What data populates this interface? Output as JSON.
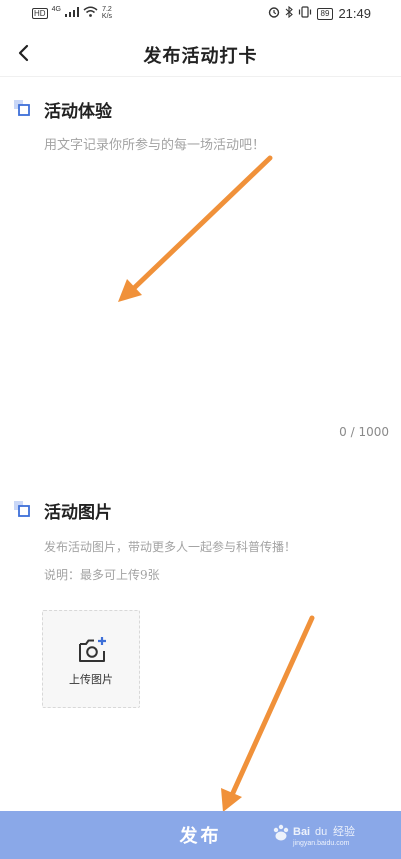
{
  "status_bar": {
    "network": "HD",
    "signal": "4G",
    "speed_value": "7.2",
    "speed_unit": "K/s",
    "battery": "89",
    "time": "21:49"
  },
  "header": {
    "title": "发布活动打卡",
    "back_icon": "chevron-left-icon"
  },
  "experience": {
    "title": "活动体验",
    "placeholder": "用文字记录你所参与的每一场活动吧！",
    "value": "",
    "counter": "0 / 1000"
  },
  "photos": {
    "title": "活动图片",
    "hint": "发布活动图片，带动更多人一起参与科普传播！",
    "note": "说明：最多可上传9张",
    "upload_label": "上传图片",
    "upload_icon": "camera-add-icon"
  },
  "footer": {
    "publish_label": "发布"
  },
  "colors": {
    "primary": "#8aa8e8",
    "accent_icon": "#3d6fd8",
    "annotation_arrow": "#f0913a"
  }
}
